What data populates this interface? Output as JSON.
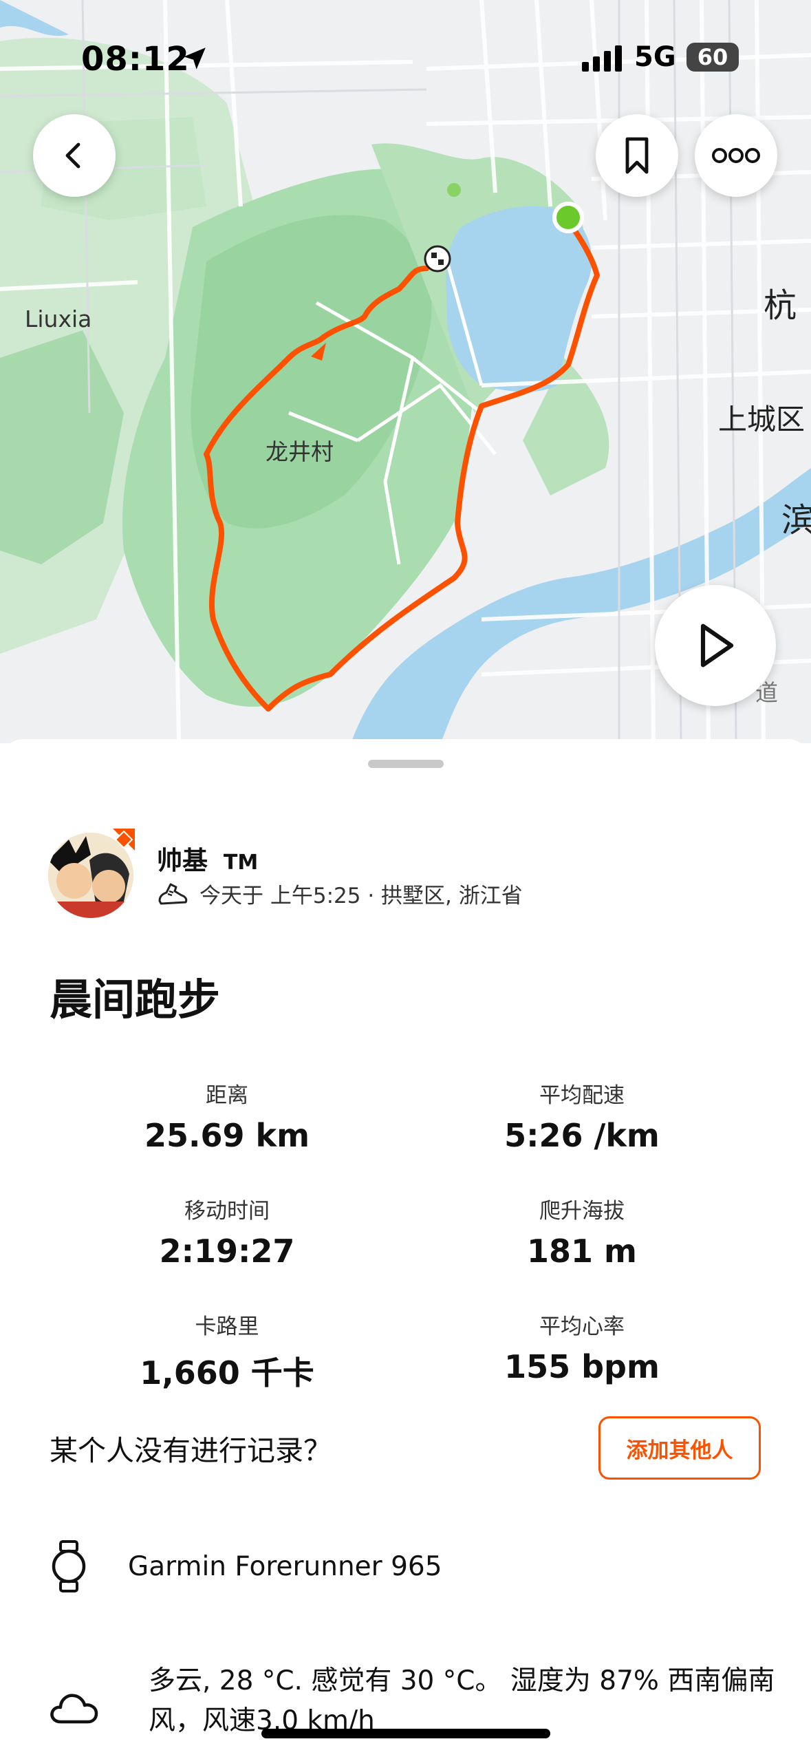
{
  "status_bar": {
    "time": "08:12",
    "network": "5G",
    "battery": "60"
  },
  "map": {
    "labels": {
      "liuxia": "Liuxia",
      "longjing": "龙井村",
      "hangzhou": "杭",
      "shangcheng": "上城区",
      "bin": "滨",
      "dao": "道"
    }
  },
  "athlete": {
    "name": "帅基",
    "tm": "TM",
    "meta": "今天于 上午5:25 · 拱墅区, 浙江省"
  },
  "activity": {
    "title": "晨间跑步",
    "stats": [
      {
        "label": "距离",
        "value": "25.69 km"
      },
      {
        "label": "平均配速",
        "value": "5:26 /km"
      },
      {
        "label": "移动时间",
        "value": "2:19:27"
      },
      {
        "label": "爬升海拔",
        "value": "181 m"
      },
      {
        "label": "卡路里",
        "value": "1,660 千卡"
      },
      {
        "label": "平均心率",
        "value": "155 bpm"
      }
    ]
  },
  "prompt": {
    "text": "某个人没有进行记录？",
    "button": "添加其他人"
  },
  "device": {
    "name": "Garmin Forerunner 965"
  },
  "weather": {
    "text": "多云, 28 °C. 感觉有 30 °C。 湿度为 87% 西南偏南 风，风速3.0 km/h"
  },
  "colors": {
    "accent": "#fc5200",
    "route": "#fc5200",
    "water": "#a6d3ee",
    "park": "#bfe5c2",
    "start": "#6cc92c"
  }
}
